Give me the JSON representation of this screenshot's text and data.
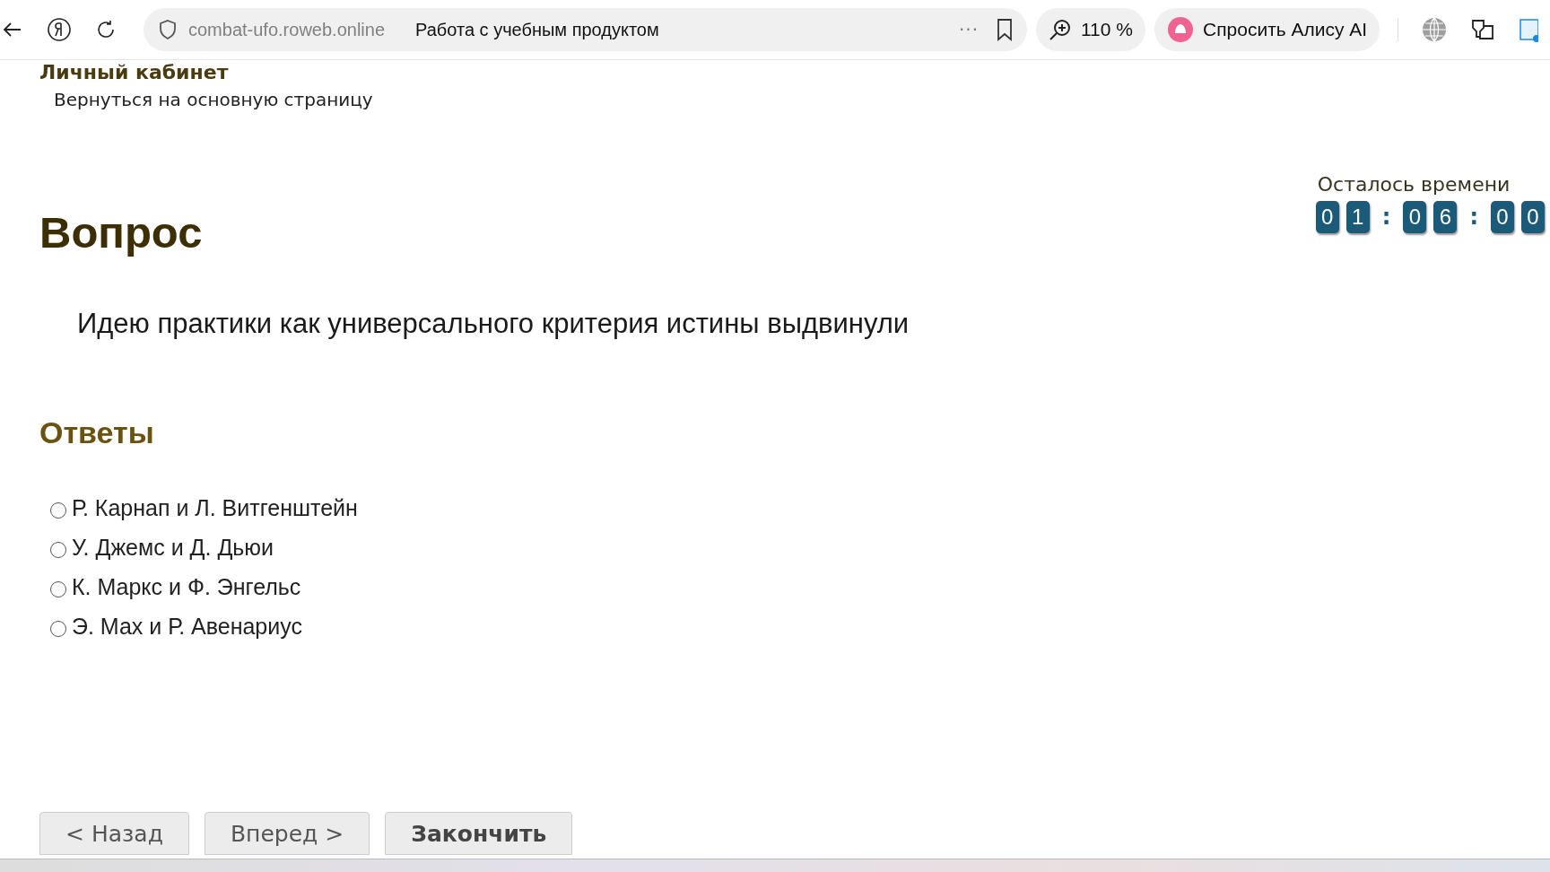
{
  "browser": {
    "address": "combat-ufo.roweb.online",
    "page_title": "Работа с учебным продуктом",
    "more": "···",
    "zoom": "110 %",
    "assistant": "Спросить Алису AI"
  },
  "header": {
    "title": "Личный кабинет",
    "back_link": "Вернуться на основную страницу"
  },
  "timer": {
    "label": "Осталось времени",
    "items": [
      {
        "kind": "digit",
        "text": "0"
      },
      {
        "kind": "digit",
        "text": "1"
      },
      {
        "kind": "separator",
        "text": ":"
      },
      {
        "kind": "digit",
        "text": "0"
      },
      {
        "kind": "digit",
        "text": "6"
      },
      {
        "kind": "separator",
        "text": ":"
      },
      {
        "kind": "digit",
        "text": "0"
      },
      {
        "kind": "digit",
        "text": "0"
      }
    ]
  },
  "question": {
    "heading": "Вопрос",
    "text": "Идею практики как универсального критерия истины выдвинули"
  },
  "answers": {
    "heading": "Ответы",
    "options": [
      {
        "label": "Р. Карнап и Л. Витгенштейн",
        "selected": false
      },
      {
        "label": "У. Джемс и Д. Дьюи",
        "selected": false
      },
      {
        "label": "К. Маркс и Ф. Энгельс",
        "selected": false
      },
      {
        "label": "Э. Мах и Р. Авенариус",
        "selected": false
      }
    ]
  },
  "buttons": [
    {
      "label": "< Назад",
      "kind": "normal"
    },
    {
      "label": "Вперед >",
      "kind": "normal"
    },
    {
      "label": "Закончить",
      "kind": "primary"
    }
  ]
}
